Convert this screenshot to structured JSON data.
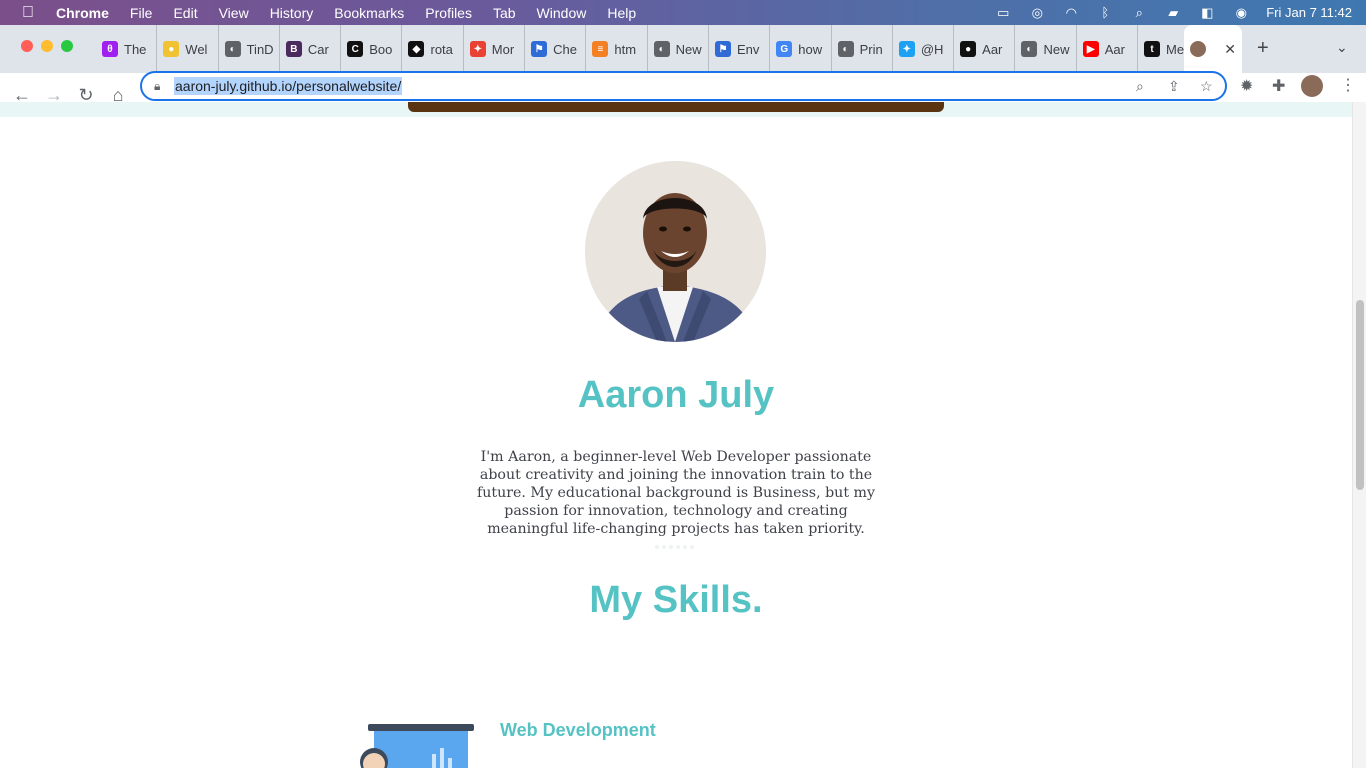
{
  "menubar": {
    "app": "Chrome",
    "items": [
      "File",
      "Edit",
      "View",
      "History",
      "Bookmarks",
      "Profiles",
      "Tab",
      "Window",
      "Help"
    ],
    "clock": "Fri Jan 7  11:42"
  },
  "tabs": [
    {
      "label": "The",
      "fav_color": "#a020f0",
      "fav_glyph": "θ"
    },
    {
      "label": "Wel",
      "fav_color": "#f1c232",
      "fav_glyph": "●"
    },
    {
      "label": "TinD",
      "fav_color": "#5f6368",
      "fav_glyph": "◐"
    },
    {
      "label": "Car",
      "fav_color": "#4b2a5e",
      "fav_glyph": "B"
    },
    {
      "label": "Boo",
      "fav_color": "#111111",
      "fav_glyph": "C"
    },
    {
      "label": "rota",
      "fav_color": "#111111",
      "fav_glyph": "◆"
    },
    {
      "label": "Mor",
      "fav_color": "#e94235",
      "fav_glyph": "✦"
    },
    {
      "label": "Che",
      "fav_color": "#2f6bd6",
      "fav_glyph": "⚑"
    },
    {
      "label": "htm",
      "fav_color": "#f48024",
      "fav_glyph": "≡"
    },
    {
      "label": "New",
      "fav_color": "#5f6368",
      "fav_glyph": "◐"
    },
    {
      "label": "Env",
      "fav_color": "#2f6bd6",
      "fav_glyph": "⚑"
    },
    {
      "label": "how",
      "fav_color": "#4285f4",
      "fav_glyph": "G"
    },
    {
      "label": "Prin",
      "fav_color": "#5f6368",
      "fav_glyph": "◐"
    },
    {
      "label": "@H",
      "fav_color": "#1da1f2",
      "fav_glyph": "✦"
    },
    {
      "label": "Aar",
      "fav_color": "#111111",
      "fav_glyph": "●"
    },
    {
      "label": "New",
      "fav_color": "#5f6368",
      "fav_glyph": "◐"
    },
    {
      "label": "Aar",
      "fav_color": "#ff0000",
      "fav_glyph": "▶"
    },
    {
      "label": "Mer",
      "fav_color": "#111111",
      "fav_glyph": "t"
    }
  ],
  "address_bar": {
    "url": "aaron-july.github.io/personalwebsite/"
  },
  "profile": {
    "name": "Aaron July",
    "bio": "I'm Aaron, a beginner-level Web Developer passionate about creativity and joining the innovation train to the future. My educational background is Business, but my passion for innovation, technology and creating meaningful life-changing projects has taken priority."
  },
  "skills": {
    "title": "My Skills.",
    "items": [
      {
        "title": "Web Development"
      }
    ]
  },
  "colors": {
    "accent": "#55c2c4",
    "body_text": "#40424a"
  }
}
